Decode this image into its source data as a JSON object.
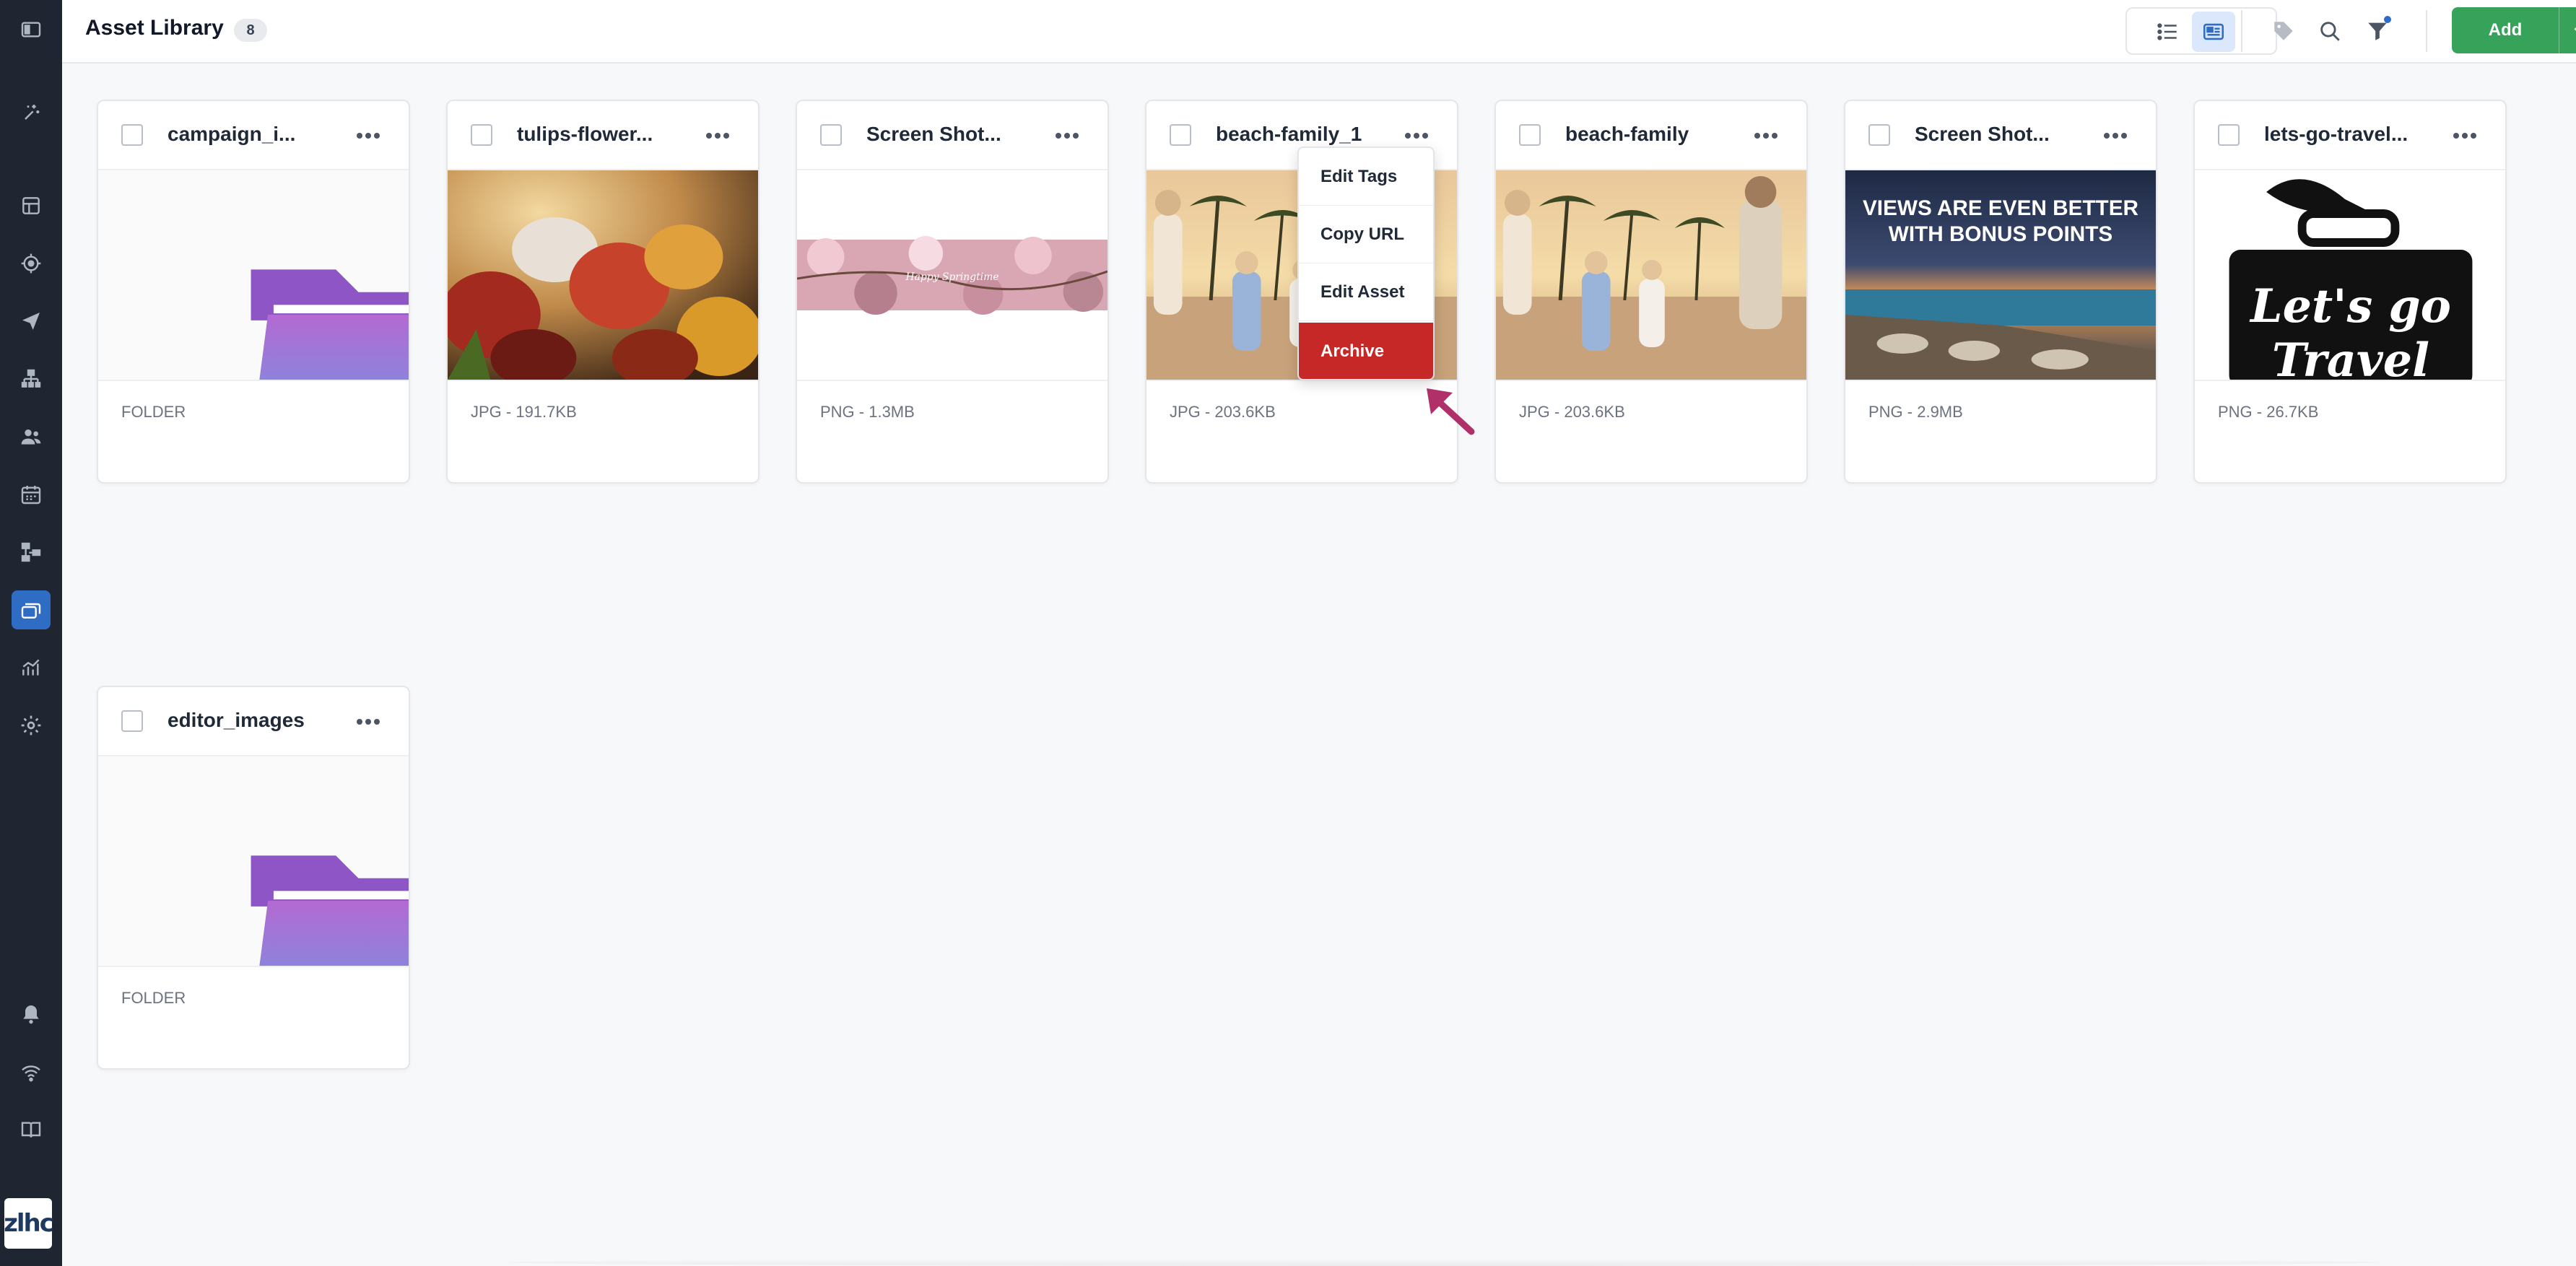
{
  "header": {
    "title": "Asset Library",
    "count": "8"
  },
  "add_button": {
    "label": "Add"
  },
  "assets": [
    {
      "name": "campaign_i...",
      "meta": "FOLDER",
      "kind": "folder"
    },
    {
      "name": "tulips-flower...",
      "meta": "JPG - 191.7KB",
      "kind": "tulips"
    },
    {
      "name": "Screen Shot...",
      "meta": "PNG - 1.3MB",
      "kind": "spring",
      "thumb_text": "Happy Springtime"
    },
    {
      "name": "beach-family_1",
      "meta": "JPG - 203.6KB",
      "kind": "beach"
    },
    {
      "name": "beach-family",
      "meta": "JPG - 203.6KB",
      "kind": "beach"
    },
    {
      "name": "Screen Shot...",
      "meta": "PNG - 2.9MB",
      "kind": "views",
      "thumb_text_1": "VIEWS ARE EVEN BETTER",
      "thumb_text_2": "WITH BONUS POINTS"
    },
    {
      "name": "lets-go-travel...",
      "meta": "PNG - 26.7KB",
      "kind": "travel",
      "thumb_text_1": "Let's go",
      "thumb_text_2": "Travel"
    },
    {
      "name": "editor_images",
      "meta": "FOLDER",
      "kind": "folder"
    }
  ],
  "context_menu": {
    "items": [
      "Edit Tags",
      "Copy URL",
      "Edit Asset",
      "Archive"
    ]
  },
  "colors": {
    "sidebar_bg": "#1f2632",
    "accent_blue": "#2f6cc4",
    "add_green": "#37a35a",
    "archive_red": "#c62828",
    "pointer_arrow": "#b0306a"
  },
  "sidebar_icons": [
    "sidebar-toggle-icon",
    "magic-icon",
    "dashboard-icon",
    "target-icon",
    "send-icon",
    "org-chart-icon",
    "contacts-icon",
    "calendar-icon",
    "workflow-icon",
    "media-library-icon",
    "analytics-icon",
    "settings-icon",
    "bell-icon",
    "signal-icon",
    "book-icon"
  ]
}
